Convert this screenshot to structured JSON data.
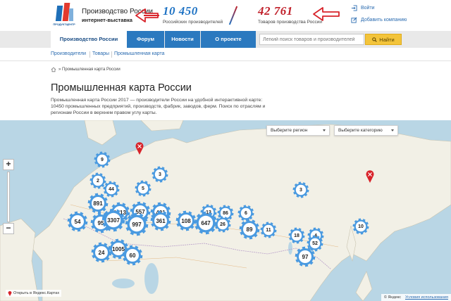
{
  "header": {
    "logo_text": "ПРОДУКТЦЕНТР",
    "site_name": "Производство России",
    "site_sub": "интернет-выставка",
    "stat1_num": "10 450",
    "stat1_label": "Российских производителей",
    "stat2_num": "42 761",
    "stat2_label": "Товаров производства России",
    "login": "Войти",
    "add_company": "Добавить компанию"
  },
  "nav": {
    "items": [
      {
        "label": "Производство России",
        "active": true
      },
      {
        "label": "Форум"
      },
      {
        "label": "Новости"
      },
      {
        "label": "О проекте"
      }
    ],
    "search_placeholder": "Легкий поиск товаров и производителей",
    "find_label": "Найти"
  },
  "subnav": [
    "Производители",
    "Товары",
    "Промышленная карта"
  ],
  "breadcrumb": "» Промышленная карта России",
  "page": {
    "title": "Промышленная карта России",
    "description": "Промышленная карта России 2017 — производители России на удобной интерактивной карте: 10450 промышленных предприятий, производств, фабрик, заводов, ферм. Поиск по отраслям и регионам России в верхнем правом углу карты."
  },
  "map": {
    "region_select": "Выберите регион",
    "category_select": "Выберите категорию",
    "open_in_yandex": "Открыть в Яндекс.Картах",
    "yandex": "© Яндекс",
    "terms": "Условия использования",
    "clusters": [
      "9",
      "2",
      "44",
      "3",
      "5",
      "3",
      "891",
      "1313",
      "557",
      "421",
      "13",
      "86",
      "6",
      "54",
      "95",
      "3307",
      "997",
      "361",
      "108",
      "647",
      "26",
      "89",
      "11",
      "18",
      "4",
      "52",
      "10",
      "24",
      "1005",
      "60",
      "97"
    ]
  },
  "colors": {
    "nav_blue": "#2b79bf",
    "stat_blue": "#1f73c4",
    "stat_red": "#c0202a",
    "find_yellow": "#f3c43b",
    "cluster_blue": "#4a9ae0",
    "sea": "#b9d6e5",
    "land": "#f2f0e6"
  }
}
